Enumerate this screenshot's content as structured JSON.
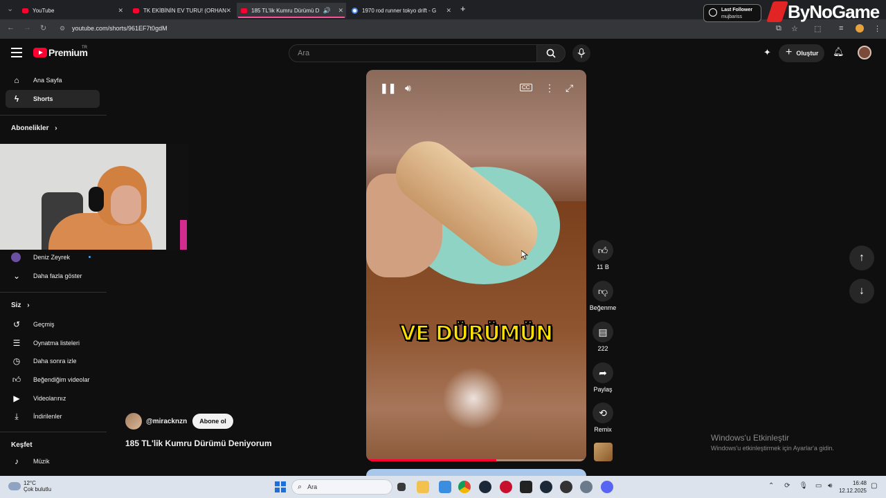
{
  "browser": {
    "tabs": [
      {
        "title": "YouTube"
      },
      {
        "title": "TK EKİBİNİN EV TURU! (ORHAN"
      },
      {
        "title": "185 TL'lik Kumru Dürümü D"
      },
      {
        "title": "1970 rod runner tokyo drift - G"
      }
    ],
    "url": "youtube.com/shorts/961EF7t0gdM"
  },
  "overlay": {
    "last_follower_label": "Last Follower",
    "last_follower_name": "mujbariss",
    "brand": "ByNoGame"
  },
  "header": {
    "logo_text": "Premium",
    "logo_region": "TR",
    "search_placeholder": "Ara",
    "create_label": "Oluştur"
  },
  "sidebar": {
    "home": "Ana Sayfa",
    "shorts": "Shorts",
    "subscriptions_heading": "Abonelikler",
    "sub_channel": "Deniz Zeyrek",
    "show_more": "Daha fazla göster",
    "you_heading": "Siz",
    "history": "Geçmiş",
    "playlists": "Oynatma listeleri",
    "watch_later": "Daha sonra izle",
    "liked": "Beğendiğim videolar",
    "your_videos": "Videolarınız",
    "downloads": "İndirilenler",
    "explore_heading": "Keşfet",
    "music": "Müzik"
  },
  "player": {
    "caption": "VE DÜRÜMÜN",
    "progress_fraction": 0.59
  },
  "actions": {
    "likes": "11 B",
    "dislike_label": "Beğenme",
    "comments": "222",
    "share_label": "Paylaş",
    "remix_label": "Remix"
  },
  "video": {
    "channel": "@miracknzn",
    "subscribe_label": "Abone ol",
    "title": "185 TL'lik Kumru Dürümü Deniyorum"
  },
  "watermark": {
    "line1": "Windows'u Etkinleştir",
    "line2": "Windows'u etkinleştirmek için Ayarlar'a gidin."
  },
  "taskbar": {
    "temp": "12°C",
    "weather": "Çok bulutlu",
    "search_placeholder": "Ara",
    "time": "16:48",
    "date": "12.12.2025"
  }
}
